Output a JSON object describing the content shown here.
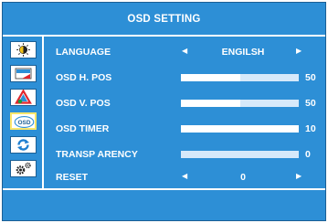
{
  "osd": {
    "title": "OSD SETTING",
    "sidebar": {
      "items": [
        {
          "icon": "brightness-icon",
          "active": false
        },
        {
          "icon": "image-icon",
          "active": false
        },
        {
          "icon": "color-icon",
          "active": false
        },
        {
          "icon": "osd-icon",
          "label": "OSD",
          "active": true
        },
        {
          "icon": "refresh-icon",
          "active": false
        },
        {
          "icon": "settings-icon",
          "active": false
        }
      ]
    },
    "settings": {
      "language": {
        "label": "LANGUAGE",
        "value": "ENGILSH"
      },
      "h_pos": {
        "label": "OSD H. POS",
        "value": "50",
        "level": 50
      },
      "v_pos": {
        "label": "OSD V. POS",
        "value": "50",
        "level": 50
      },
      "timer": {
        "label": "OSD TIMER",
        "value": "10",
        "level": 100
      },
      "transparency": {
        "label": "TRANSP ARENCY",
        "value": "0",
        "level": 0
      },
      "reset": {
        "label": "RESET",
        "value": "0"
      }
    },
    "colors": {
      "background": "#2d8fd6",
      "text": "#ffffff",
      "active_border": "#ffe66a"
    }
  }
}
